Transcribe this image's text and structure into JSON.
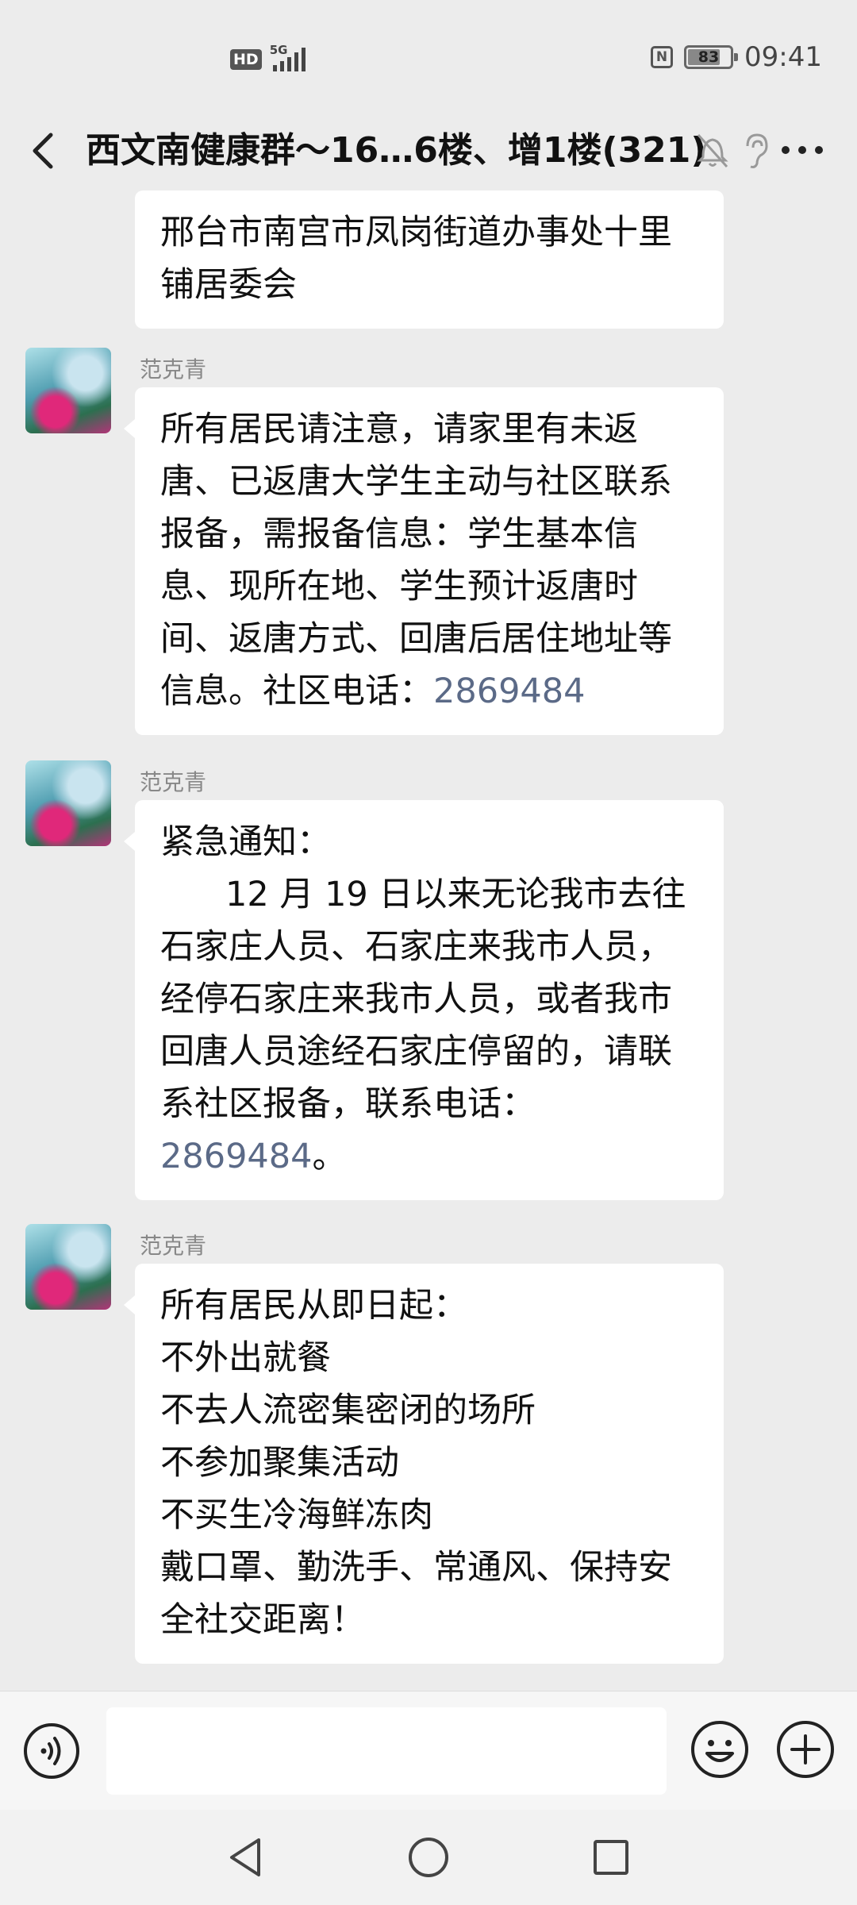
{
  "status_bar": {
    "hd_label": "HD",
    "network_label": "5G",
    "battery_level": "83",
    "time": "09:41"
  },
  "title_bar": {
    "title": "西文南健康群～16…6楼、增1楼(321)"
  },
  "messages": [
    {
      "sender": "",
      "text": "邢台市南宫市凤岗街道办事处十里\n铺居委会",
      "phone": "",
      "suffix": ""
    },
    {
      "sender": "范克青",
      "text": "所有居民请注意，请家里有未返\n唐、已返唐大学生主动与社区联系\n报备，需报备信息：学生基本信\n息、现所在地、学生预计返唐时\n间、返唐方式、回唐后居住地址等\n信息。社区电话：",
      "phone": "2869484",
      "suffix": ""
    },
    {
      "sender": "范克青",
      "text": "紧急通知：\n      12 月 19 日以来无论我市去往\n石家庄人员、石家庄来我市人员，\n经停石家庄来我市人员，或者我市\n回唐人员途经石家庄停留的，请联\n系社区报备，联系电话：\n",
      "phone": "2869484",
      "suffix": "。"
    },
    {
      "sender": "范克青",
      "text": "所有居民从即日起：\n不外出就餐\n不去人流密集密闭的场所\n不参加聚集活动\n不买生冷海鲜冻肉\n戴口罩、勤洗手、常通风、保持安\n全社交距离！",
      "phone": "",
      "suffix": ""
    }
  ],
  "input_bar": {
    "placeholder": ""
  },
  "icons": {
    "back": "back-arrow-icon",
    "mute": "mute-bell-icon",
    "ear": "ear-icon",
    "more": "more-icon",
    "voice": "voice-icon",
    "emoji": "emoji-icon",
    "plus": "plus-icon"
  }
}
